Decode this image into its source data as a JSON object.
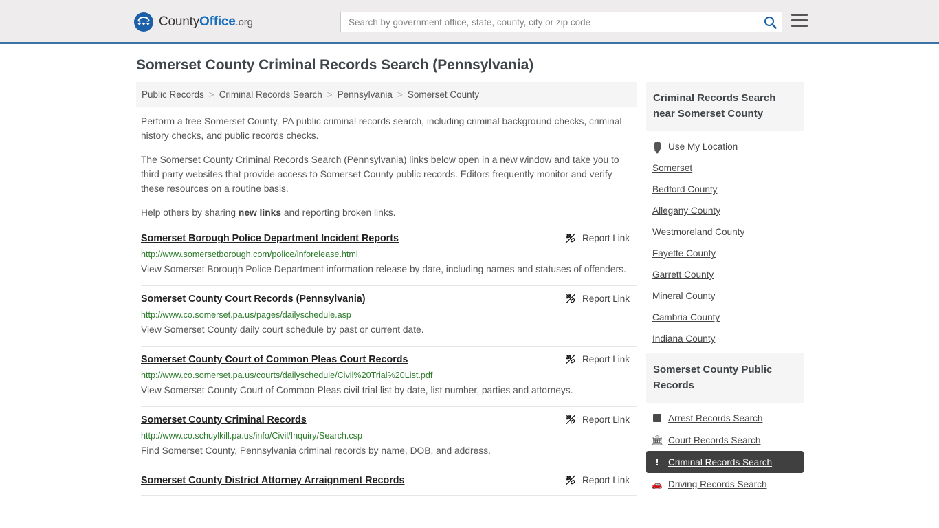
{
  "header": {
    "brand": {
      "part1": "County",
      "part2": "Office",
      "part3": ".org",
      "logo_icon": "eagle-seal-icon",
      "stars": "★★★"
    },
    "search": {
      "placeholder": "Search by government office, state, county, city or zip code",
      "value": "",
      "icon": "search-icon"
    },
    "menu_icon": "hamburger-menu-icon"
  },
  "page": {
    "title": "Somerset County Criminal Records Search (Pennsylvania)"
  },
  "breadcrumb": {
    "separator": ">",
    "items": [
      {
        "label": "Public Records"
      },
      {
        "label": "Criminal Records Search"
      },
      {
        "label": "Pennsylvania"
      },
      {
        "label": "Somerset County"
      }
    ]
  },
  "intro": {
    "p1": "Perform a free Somerset County, PA public criminal records search, including criminal background checks, criminal history checks, and public records checks.",
    "p2": "The Somerset County Criminal Records Search (Pennsylvania) links below open in a new window and take you to third party websites that provide access to Somerset County public records. Editors frequently monitor and verify these resources on a routine basis.",
    "p3_before": "Help others by sharing ",
    "p3_link": "new links",
    "p3_after": " and reporting broken links."
  },
  "report_link": {
    "label": "Report Link",
    "icon": "broken-link-icon"
  },
  "results": [
    {
      "title": "Somerset Borough Police Department Incident Reports",
      "url": "http://www.somersetborough.com/police/inforelease.html",
      "description": "View Somerset Borough Police Department information release by date, including names and statuses of offenders."
    },
    {
      "title": "Somerset County Court Records (Pennsylvania)",
      "url": "http://www.co.somerset.pa.us/pages/dailyschedule.asp",
      "description": "View Somerset County daily court schedule by past or current date."
    },
    {
      "title": "Somerset County Court of Common Pleas Court Records",
      "url": "http://www.co.somerset.pa.us/courts/dailyschedule/Civil%20Trial%20List.pdf",
      "description": "View Somerset County Court of Common Pleas civil trial list by date, list number, parties and attorneys."
    },
    {
      "title": "Somerset County Criminal Records",
      "url": "http://www.co.schuylkill.pa.us/info/Civil/Inquiry/Search.csp",
      "description": "Find Somerset County, Pennsylvania criminal records by name, DOB, and address."
    },
    {
      "title": "Somerset County District Attorney Arraignment Records",
      "url": "",
      "description": ""
    }
  ],
  "sidebar": {
    "nearby": {
      "heading": "Criminal Records Search near Somerset County",
      "items": [
        {
          "label": "Use My Location",
          "icon": "map-pin-icon"
        },
        {
          "label": "Somerset",
          "icon": ""
        },
        {
          "label": "Bedford County",
          "icon": ""
        },
        {
          "label": "Allegany County",
          "icon": ""
        },
        {
          "label": "Westmoreland County",
          "icon": ""
        },
        {
          "label": "Fayette County",
          "icon": ""
        },
        {
          "label": "Garrett County",
          "icon": ""
        },
        {
          "label": "Mineral County",
          "icon": ""
        },
        {
          "label": "Cambria County",
          "icon": ""
        },
        {
          "label": "Indiana County",
          "icon": ""
        }
      ]
    },
    "public_records": {
      "heading": "Somerset County Public Records",
      "items": [
        {
          "label": "Arrest Records Search",
          "icon": "fingerprint-square-icon",
          "active": false
        },
        {
          "label": "Court Records Search",
          "icon": "courthouse-icon",
          "active": false
        },
        {
          "label": "Criminal Records Search",
          "icon": "exclamation-icon",
          "active": true
        },
        {
          "label": "Driving Records Search",
          "icon": "car-icon",
          "active": false
        }
      ]
    }
  },
  "colors": {
    "header_bg": "#eeecec",
    "header_border": "#3a72a8",
    "brand_blue": "#1a6ec0",
    "url_green": "#2a7a2a",
    "active_bg": "#404040",
    "panel_bg": "#f5f5f5"
  }
}
